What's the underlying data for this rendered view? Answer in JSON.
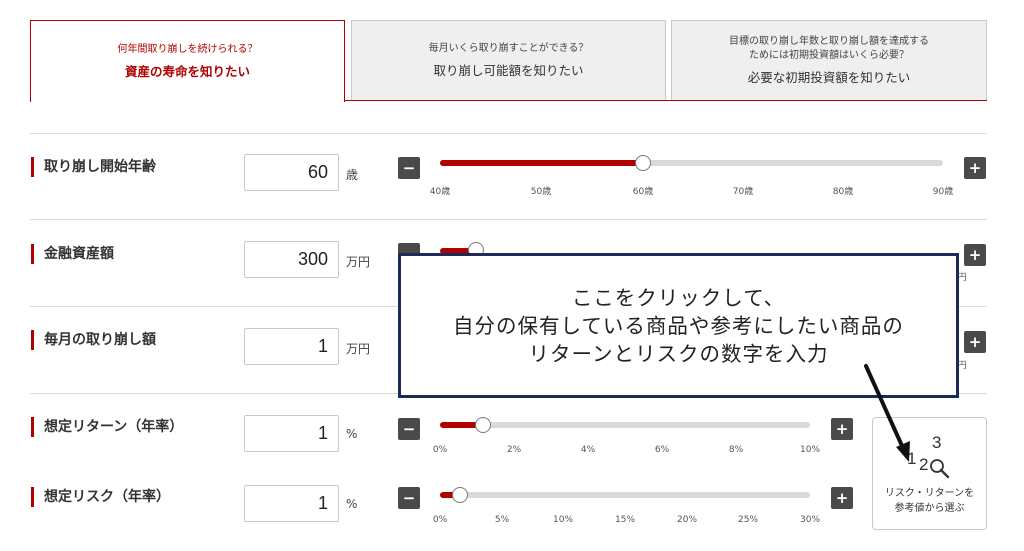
{
  "tabs": [
    {
      "sub": "何年間取り崩しを続けられる？",
      "main": "資産の寿命を知りたい"
    },
    {
      "sub": "毎月いくら取り崩すことができる？",
      "main": "取り崩し可能額を知りたい"
    },
    {
      "sub1": "目標の取り崩し年数と取り崩し額を達成する",
      "sub2": "ためには初期投資額はいくら必要？",
      "main": "必要な初期投資額を知りたい"
    }
  ],
  "rows": {
    "start_age": {
      "label": "取り崩し開始年齢",
      "value": "60",
      "unit": "歳",
      "ticks": [
        "40歳",
        "50歳",
        "60歳",
        "70歳",
        "80歳",
        "90歳"
      ],
      "level": 0.4
    },
    "assets": {
      "label": "金融資産額",
      "value": "300",
      "unit": "万円",
      "tick_right": "円"
    },
    "monthly": {
      "label": "毎月の取り崩し額",
      "value": "1",
      "unit": "万円",
      "tick_right": "円"
    },
    "return": {
      "label": "想定リターン（年率）",
      "value": "1",
      "unit": "%",
      "ticks": [
        "0%",
        "2%",
        "4%",
        "6%",
        "8%",
        "10%"
      ],
      "level": 0.1
    },
    "risk": {
      "label": "想定リスク（年率）",
      "value": "1",
      "unit": "%",
      "ticks": [
        "0%",
        "5%",
        "10%",
        "15%",
        "20%",
        "25%",
        "30%"
      ],
      "level": 0.0333
    }
  },
  "buttons": {
    "minus": "−",
    "plus": "+"
  },
  "callout": {
    "line1": "ここをクリックして、",
    "line2": "自分の保有している商品や参考にしたい商品の",
    "line3": "リターンとリスクの数字を入力"
  },
  "ref_button": {
    "line1": "リスク・リターンを",
    "line2": "参考値から選ぶ",
    "digits": "123"
  },
  "colors": {
    "accent": "#b00000",
    "callout_border": "#1c2a59",
    "button_dark": "#4a4a4a"
  }
}
